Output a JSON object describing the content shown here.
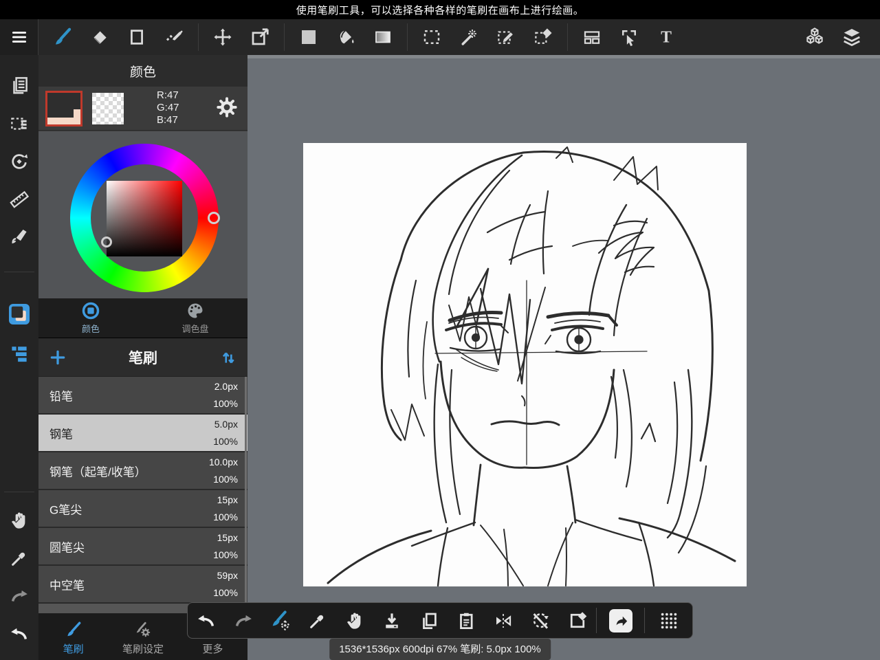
{
  "notification": {
    "text": "使用笔刷工具，可以选择各种各样的笔刷在画布上进行绘画。"
  },
  "color_panel": {
    "title": "颜色",
    "rgb_r": "R:47",
    "rgb_g": "G:47",
    "rgb_b": "B:47",
    "foreground_color": "#2f2f2f",
    "background_color": "#f6d9c8",
    "tabs": [
      {
        "label": "颜色"
      },
      {
        "label": "调色盘"
      }
    ]
  },
  "brush_panel": {
    "title": "笔刷",
    "brushes": [
      {
        "name": "铅笔",
        "size": "2.0px",
        "opacity": "100%",
        "selected": false
      },
      {
        "name": "钢笔",
        "size": "5.0px",
        "opacity": "100%",
        "selected": true
      },
      {
        "name": "钢笔（起笔/收笔）",
        "size": "10.0px",
        "opacity": "100%",
        "selected": false
      },
      {
        "name": "G笔尖",
        "size": "15px",
        "opacity": "100%",
        "selected": false
      },
      {
        "name": "圆笔尖",
        "size": "15px",
        "opacity": "100%",
        "selected": false
      },
      {
        "name": "中空笔",
        "size": "59px",
        "opacity": "100%",
        "selected": false
      }
    ]
  },
  "bottom_tabs": [
    {
      "label": "笔刷"
    },
    {
      "label": "笔刷设定"
    },
    {
      "label": "更多"
    }
  ],
  "status_bar": {
    "text": "1536*1536px 600dpi 67% 笔刷: 5.0px 100%"
  },
  "icons": {
    "text_tool_glyph": "T"
  },
  "colors": {
    "accent": "#3f9be0",
    "workspace": "#6b7076",
    "selected_row": "#c9c9c9"
  }
}
